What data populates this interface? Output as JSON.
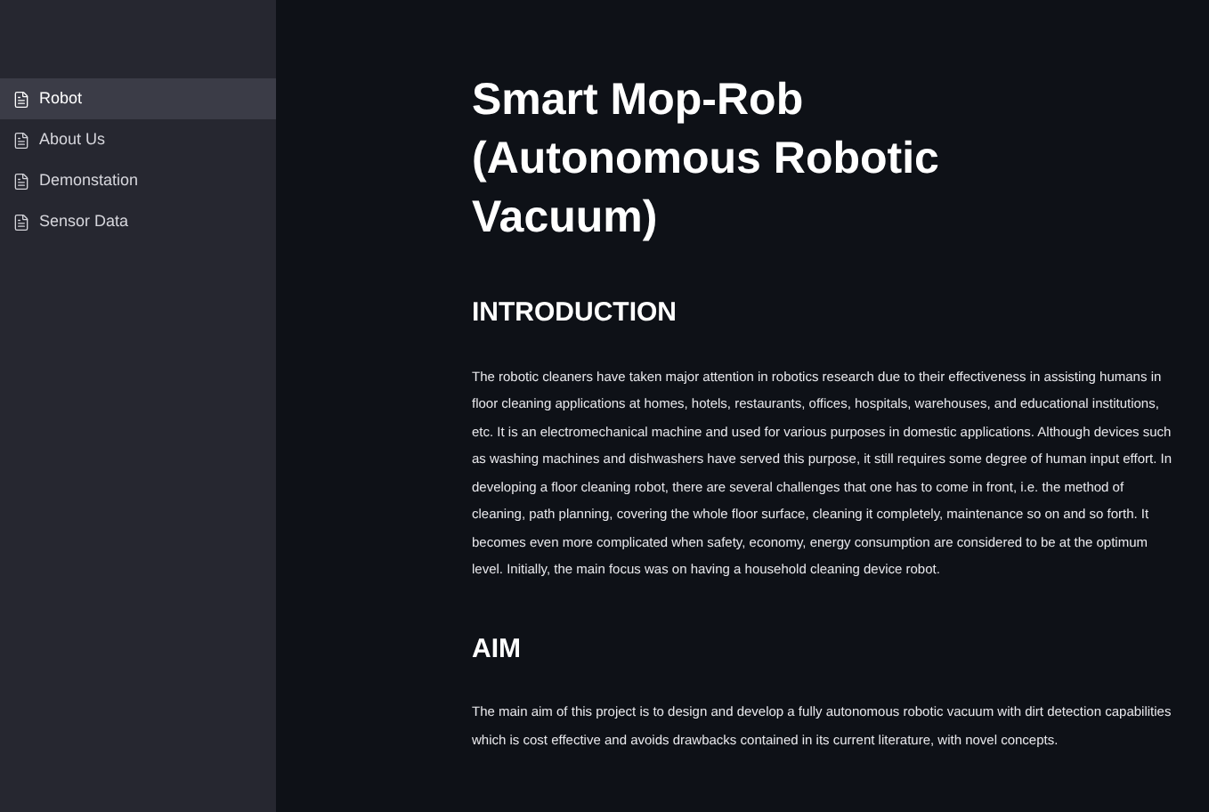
{
  "sidebar": {
    "items": [
      {
        "label": "Robot",
        "selected": true
      },
      {
        "label": "About Us",
        "selected": false
      },
      {
        "label": "Demonstation",
        "selected": false
      },
      {
        "label": "Sensor Data",
        "selected": false
      }
    ]
  },
  "main": {
    "title": "Smart Mop-Rob (Autonomous Robotic Vacuum)",
    "sections": [
      {
        "heading": "INTRODUCTION",
        "text": "The robotic cleaners have taken major attention in robotics research due to their effectiveness in assisting humans in floor cleaning applications at homes, hotels, restaurants, offices, hospitals, warehouses, and educational institutions, etc. It is an electromechanical machine and used for various purposes in domestic applications. Although devices such as washing machines and dishwashers have served this purpose, it still requires some degree of human input effort. In developing a floor cleaning robot, there are several challenges that one has to come in front, i.e. the method of cleaning, path planning, covering the whole floor surface, cleaning it completely, maintenance so on and so forth. It becomes even more complicated when safety, economy, energy consumption are considered to be at the optimum level. Initially, the main focus was on having a household cleaning device robot."
      },
      {
        "heading": "AIM",
        "text": "The main aim of this project is to design and develop a fully autonomous robotic vacuum with dirt detection capabilities which is cost effective and avoids drawbacks contained in its current literature, with novel concepts."
      }
    ]
  }
}
